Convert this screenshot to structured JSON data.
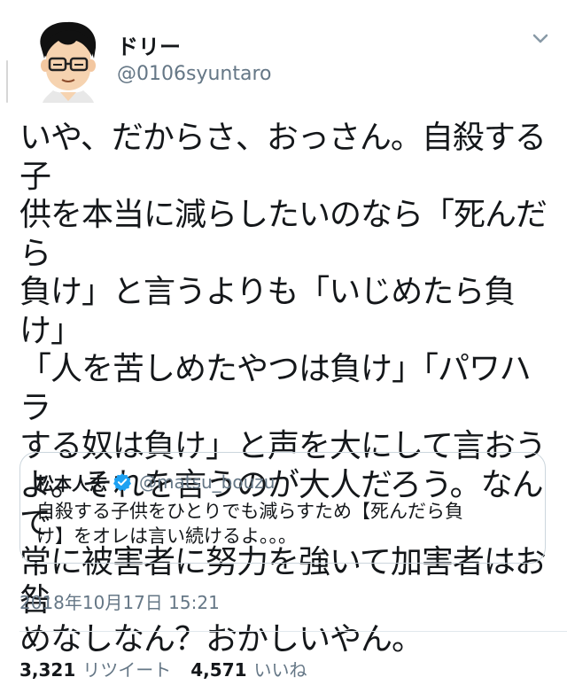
{
  "tweet": {
    "author": {
      "display_name": "ドリー",
      "handle": "@0106syuntaro"
    },
    "text": "いや、だからさ、おっさん。自殺する子\n供を本当に減らしたいのなら「死んだら\n負け」と言うよりも「いじめたら負け」\n「人を苦しめたやつは負け」「パワハラ\nする奴は負け」と声を大にして言おう\nよ。それを言うのが大人だろう。なんで\n常に被害者に努力を強いて加害者はお咎\nめなしなん？おかしいやん。",
    "quoted": {
      "display_name": "松本人志",
      "verified": true,
      "handle": "@matsu_bouzu",
      "text": "自殺する子供をひとりでも減らすため【死んだら負\nけ】をオレは言い続けるよ。。。"
    },
    "timestamp": "2018年10月17日 15:21",
    "stats": {
      "retweets_count": "3,321",
      "retweets_label": "リツイート",
      "likes_count": "4,571",
      "likes_label": "いいね"
    }
  },
  "icons": {
    "caret": "chevron-down-icon",
    "verified": "verified-badge-icon",
    "avatar": "avatar-illustration"
  },
  "colors": {
    "text": "#14171a",
    "secondary": "#657786",
    "border": "#ccd6dd",
    "verified": "#1da1f2"
  }
}
